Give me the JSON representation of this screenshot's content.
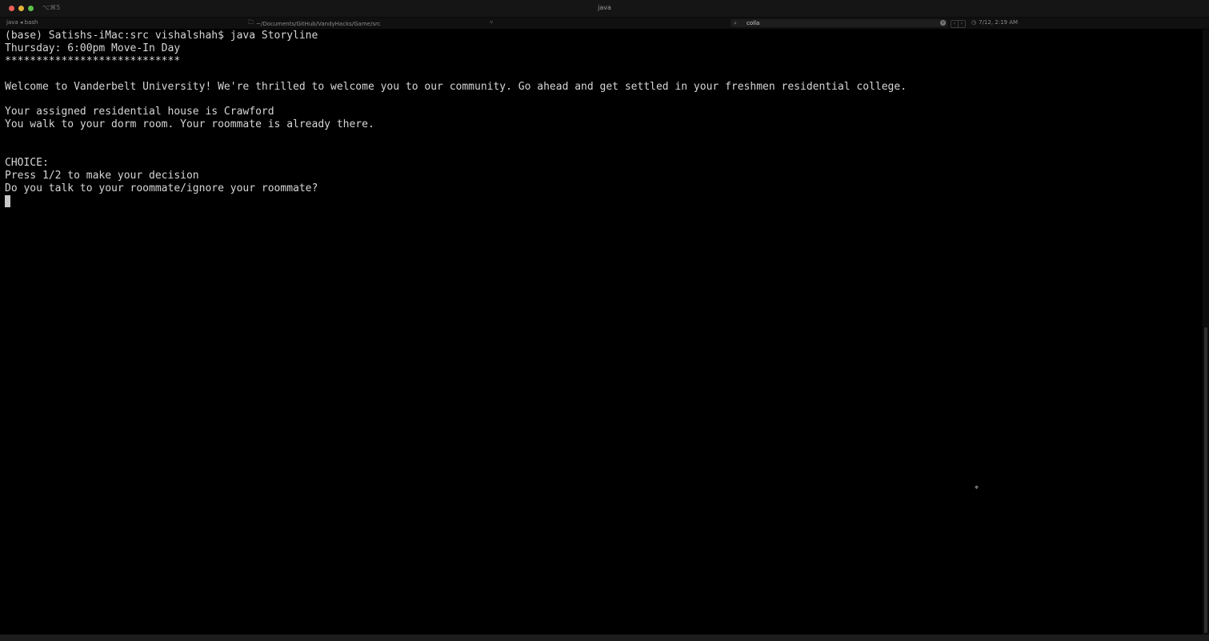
{
  "window": {
    "title": "java",
    "shortcut": "⌥⌘5"
  },
  "statusbar": {
    "process": "java ◂ bash",
    "path": "~/Documents/GitHub/VandyHacks/Game/src",
    "git_icon": "branch-icon",
    "search_value": "colla",
    "clock": "7/12, 2:19 AM"
  },
  "terminal": {
    "lines": [
      "(base) Satishs-iMac:src vishalshah$ java Storyline",
      "Thursday: 6:00pm Move-In Day",
      "****************************",
      "",
      "Welcome to Vanderbelt University! We're thrilled to welcome you to our community. Go ahead and get settled in your freshmen residential college.",
      "",
      "Your assigned residential house is Crawford",
      "You walk to your dorm room. Your roommate is already there.",
      "",
      "",
      "CHOICE:",
      "Press 1/2 to make your decision",
      "Do you talk to your roommate/ignore your roommate?"
    ]
  },
  "colors": {
    "background": "#000000",
    "text": "#d6d6d6",
    "close": "#ec5f5a",
    "minimize": "#e5b33a",
    "maximize": "#5cc14a"
  }
}
